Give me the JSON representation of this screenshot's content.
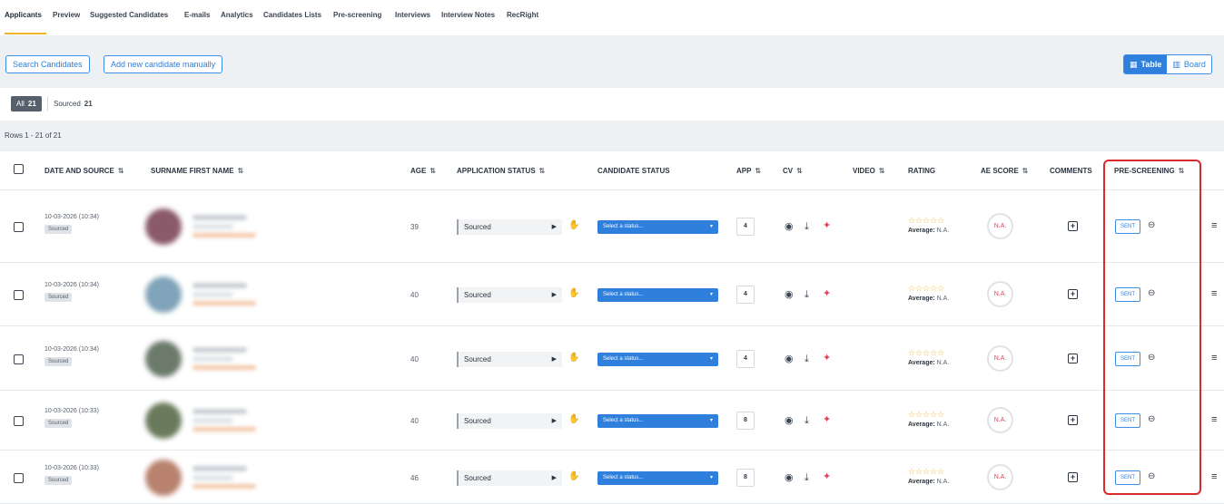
{
  "tabs": [
    "Applicants",
    "Preview",
    "Suggested Candidates",
    "E-mails",
    "Analytics",
    "Candidates Lists",
    "Pre-screening",
    "Interviews",
    "Interview Notes",
    "RecRight"
  ],
  "actions": {
    "search_label": "Search Candidates",
    "add_label": "Add new candidate manually",
    "view_table_label": "Table",
    "view_board_label": "Board"
  },
  "filters": {
    "all_label": "All",
    "all_count": "21",
    "sourced_label": "Sourced",
    "sourced_count": "21"
  },
  "rows_info": "Rows 1 - 21 of 21",
  "columns": {
    "date_source": "DATE AND SOURCE",
    "name": "SURNAME FIRST NAME",
    "age": "AGE",
    "app_status": "APPLICATION STATUS",
    "cand_status": "CANDIDATE STATUS",
    "app": "APP",
    "cv": "CV",
    "video": "VIDEO",
    "rating": "RATING",
    "ae_score": "AE SCORE",
    "comments": "COMMENTS",
    "prescreening": "PRE-SCREENING"
  },
  "rows": [
    {
      "date": "10-03-2026 (10:34)",
      "source": "Sourced",
      "age": "39",
      "app_status": "Sourced",
      "cand_status": "Select a status...",
      "app": "4",
      "stars": "☆☆☆☆☆",
      "avg_label": "Average:",
      "avg_value": "N.A.",
      "ae": "N.A.",
      "prescreen": "SENT",
      "avatar_color": "#8a5a6a"
    },
    {
      "date": "10-03-2026 (10:34)",
      "source": "Sourced",
      "age": "40",
      "app_status": "Sourced",
      "cand_status": "Select a status...",
      "app": "4",
      "stars": "☆☆☆☆☆",
      "avg_label": "Average:",
      "avg_value": "N.A.",
      "ae": "N.A.",
      "prescreen": "SENT",
      "avatar_color": "#7fa3b8"
    },
    {
      "date": "10-03-2026 (10:34)",
      "source": "Sourced",
      "age": "40",
      "app_status": "Sourced",
      "cand_status": "Select a status...",
      "app": "4",
      "stars": "☆☆☆☆☆",
      "avg_label": "Average:",
      "avg_value": "N.A.",
      "ae": "N.A.",
      "prescreen": "SENT",
      "avatar_color": "#6b7a6a"
    },
    {
      "date": "10-03-2026 (10:33)",
      "source": "Sourced",
      "age": "40",
      "app_status": "Sourced",
      "cand_status": "Select a status...",
      "app": "8",
      "stars": "☆☆☆☆☆",
      "avg_label": "Average:",
      "avg_value": "N.A.",
      "ae": "N.A.",
      "prescreen": "SENT",
      "avatar_color": "#6a7b5c"
    },
    {
      "date": "10-03-2026 (10:33)",
      "source": "Sourced",
      "age": "46",
      "app_status": "Sourced",
      "cand_status": "Select a status...",
      "app": "8",
      "stars": "☆☆☆☆☆",
      "avg_label": "Average:",
      "avg_value": "N.A.",
      "ae": "N.A.",
      "prescreen": "SENT",
      "avatar_color": "#b8826e"
    }
  ],
  "colors": {
    "accent": "#2f7fdc",
    "tab_underline": "#f0b429",
    "highlight": "#d82a2a",
    "ae_text": "#e2435b"
  }
}
